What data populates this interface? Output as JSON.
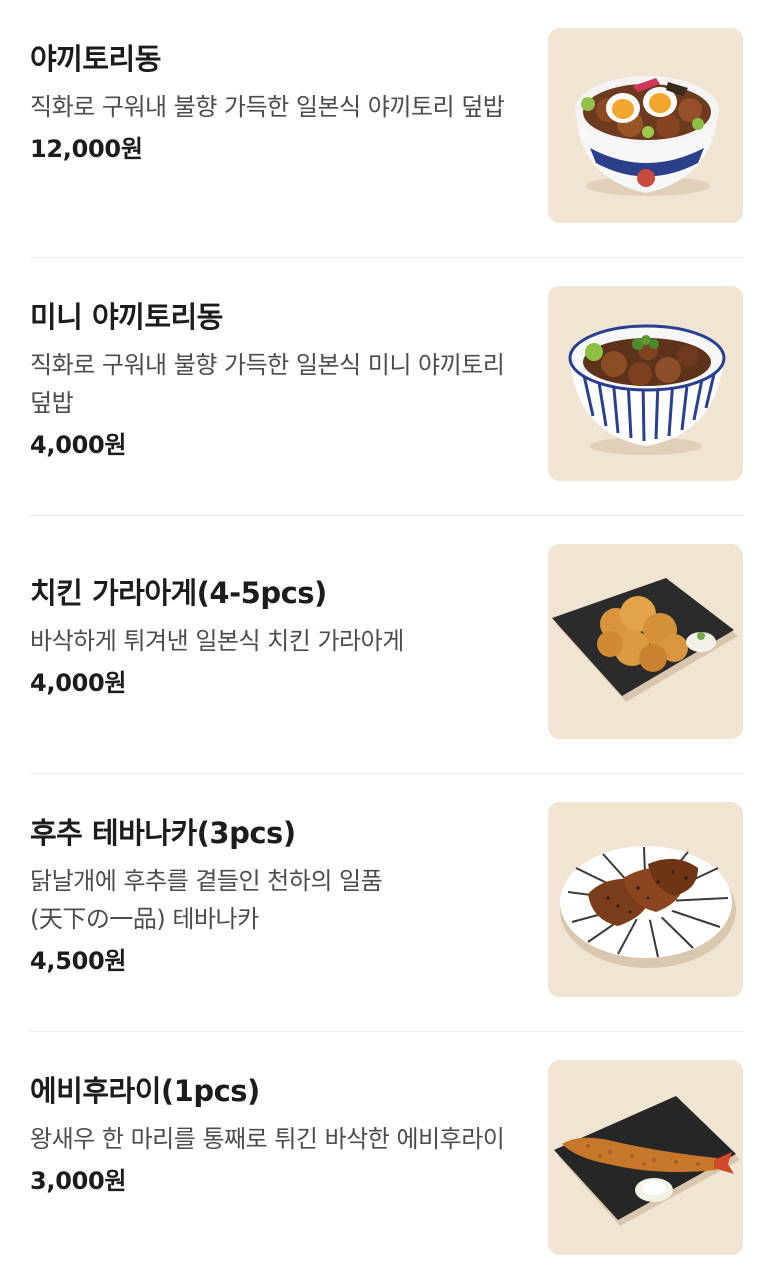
{
  "menu": {
    "items": [
      {
        "name": "야끼토리동",
        "description": "직화로 구워내 불향 가득한 일본식 야끼토리 덮밥",
        "price": "12,000원",
        "image": "yakitori-don-bowl"
      },
      {
        "name": "미니 야끼토리동",
        "description": "직화로 구워내 불향 가득한 일본식 미니 야끼토리 덮밥",
        "price": "4,000원",
        "image": "mini-yakitori-don-bowl"
      },
      {
        "name": "치킨 가라아게(4-5pcs)",
        "description": "바삭하게 튀겨낸 일본식 치킨 가라아게",
        "price": "4,000원",
        "image": "chicken-karaage-plate"
      },
      {
        "name": "후추 테바나카(3pcs)",
        "description": "닭날개에 후추를 곁들인 천하의 일품(天下の一品) 테바나카",
        "price": "4,500원",
        "image": "pepper-tebanaka-plate"
      },
      {
        "name": "에비후라이(1pcs)",
        "description": "왕새우 한 마리를 통째로 튀긴 바삭한 에비후라이",
        "price": "3,000원",
        "image": "ebi-fry-plate"
      }
    ]
  },
  "colors": {
    "thumb_background": "#efe3d2",
    "divider": "#ececec",
    "text_primary": "#1c1c1c",
    "text_secondary": "#4d4d4d"
  }
}
